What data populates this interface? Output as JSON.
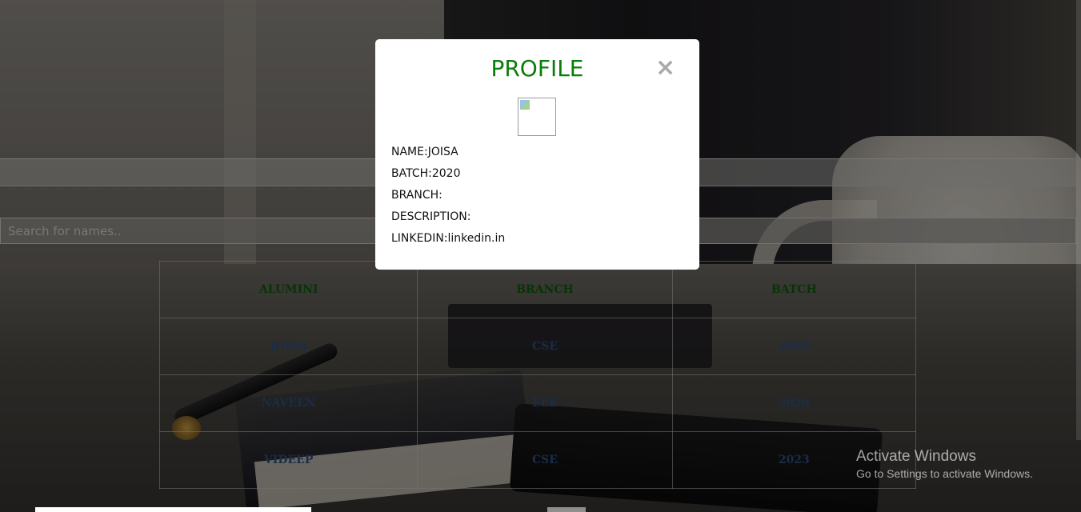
{
  "search": {
    "placeholder": "Search for names.."
  },
  "table": {
    "headers": [
      "ALUMINI",
      "BRANCH",
      "BATCH"
    ],
    "rows": [
      [
        "JOISA",
        "CSE",
        "2020"
      ],
      [
        "NAVEEN",
        "EEE",
        "2020"
      ],
      [
        "VIDEEP",
        "CSE",
        "2023"
      ]
    ]
  },
  "modal": {
    "title": "PROFILE",
    "close_symbol": "×",
    "name": "NAME:JOISA",
    "batch": "BATCH:2020",
    "branch": "BRANCH:",
    "description": "DESCRIPTION:",
    "linkedin": "LINKEDIN:linkedin.in"
  },
  "watermark": {
    "line1": "Activate Windows",
    "line2": "Go to Settings to activate Windows."
  },
  "colors": {
    "modal_title": "#0a7d0a",
    "table_header": "#0c5a0c",
    "table_cell": "#2d4e7a"
  }
}
